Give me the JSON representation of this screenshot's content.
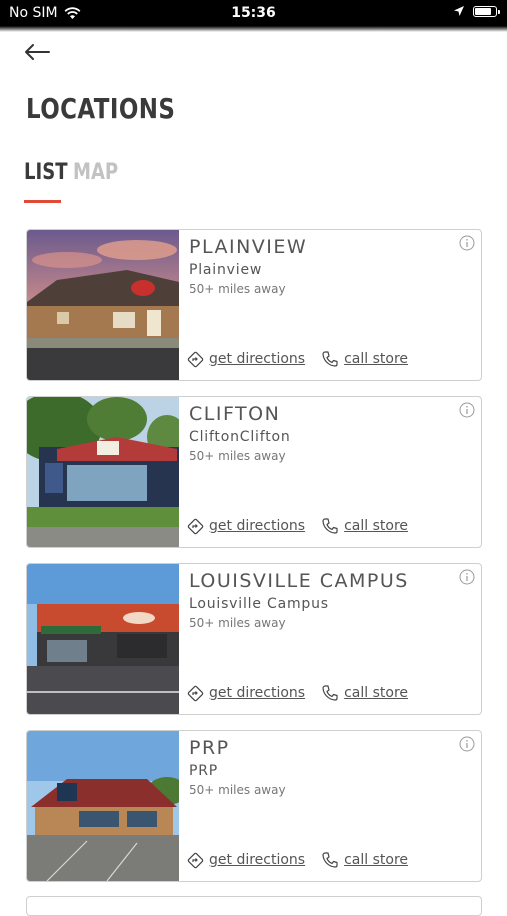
{
  "status_bar": {
    "carrier": "No SIM",
    "time": "15:36"
  },
  "header": {
    "title": "LOCATIONS"
  },
  "tabs": [
    {
      "label": "LIST",
      "active": true
    },
    {
      "label": "MAP",
      "active": false
    }
  ],
  "colors": {
    "accent": "#e14b35",
    "text": "#3a3a3a",
    "inactive_tab": "#c2c2c2",
    "card_border": "#cfcfcf"
  },
  "icons": {
    "back": "arrow-left-icon",
    "info": "info-circle-icon",
    "directions": "directions-diamond-icon",
    "call": "phone-icon",
    "wifi": "wifi-icon",
    "location": "location-arrow-icon",
    "battery": "battery-icon"
  },
  "locations": [
    {
      "name": "PLAINVIEW",
      "subtitle": "Plainview",
      "distance": "50+ miles away",
      "directions_label": "get directions",
      "call_label": "call store"
    },
    {
      "name": "CLIFTON",
      "subtitle": "CliftonClifton",
      "distance": "50+ miles away",
      "directions_label": "get directions",
      "call_label": "call store"
    },
    {
      "name": "LOUISVILLE CAMPUS",
      "subtitle": "Louisville Campus",
      "distance": "50+ miles away",
      "directions_label": "get directions",
      "call_label": "call store"
    },
    {
      "name": "PRP",
      "subtitle": "PRP",
      "distance": "50+ miles away",
      "directions_label": "get directions",
      "call_label": "call store"
    }
  ]
}
